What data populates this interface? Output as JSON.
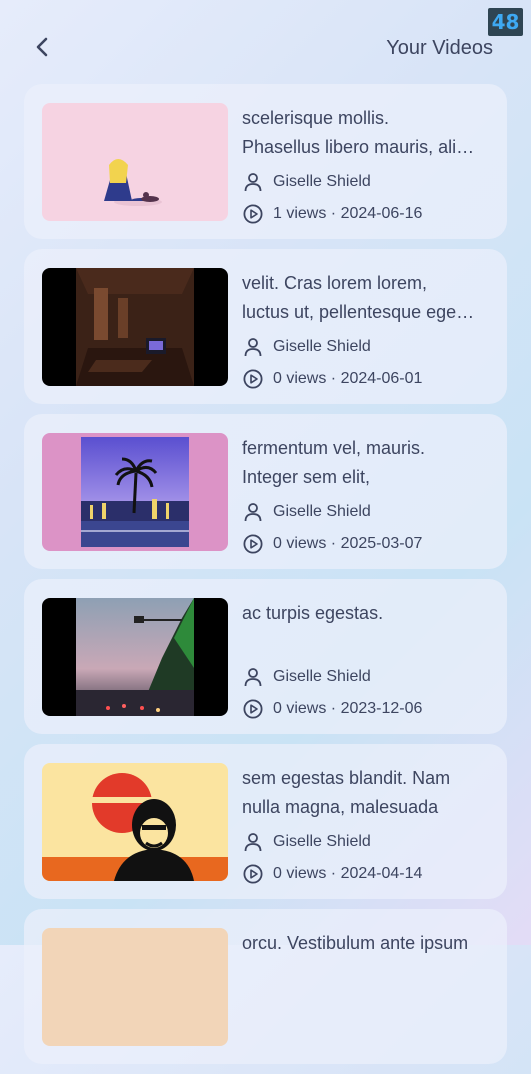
{
  "status_badge": "48",
  "header": {
    "title": "Your Videos"
  },
  "videos": [
    {
      "desc_line1": "scelerisque mollis.",
      "desc_line2": "Phasellus libero mauris, ali…",
      "author": "Giselle Shield",
      "stats": "1 views · 2024-06-16",
      "thumb": "pink-anime-girl"
    },
    {
      "desc_line1": "velit. Cras lorem lorem,",
      "desc_line2": "luctus ut, pellentesque ege…",
      "author": "Giselle Shield",
      "stats": "0 views · 2024-06-01",
      "thumb": "dark-room-tv"
    },
    {
      "desc_line1": "fermentum vel, mauris.",
      "desc_line2": "Integer sem elit,",
      "author": "Giselle Shield",
      "stats": "0 views · 2025-03-07",
      "thumb": "palm-city-sunset"
    },
    {
      "desc_line1": "ac turpis egestas.",
      "desc_line2": "",
      "author": "Giselle Shield",
      "stats": "0 views · 2023-12-06",
      "thumb": "road-traffic-dusk"
    },
    {
      "desc_line1": "sem egestas blandit. Nam",
      "desc_line2": "nulla magna, malesuada",
      "author": "Giselle Shield",
      "stats": "0 views · 2024-04-14",
      "thumb": "red-sun-silhouette"
    },
    {
      "desc_line1": "orcu. Vestibulum ante ipsum",
      "desc_line2": "",
      "author": "",
      "stats": "",
      "thumb": "peach"
    }
  ],
  "icons": {
    "back": "chevron-left-icon",
    "author": "user-icon",
    "views": "play-circle-icon"
  }
}
